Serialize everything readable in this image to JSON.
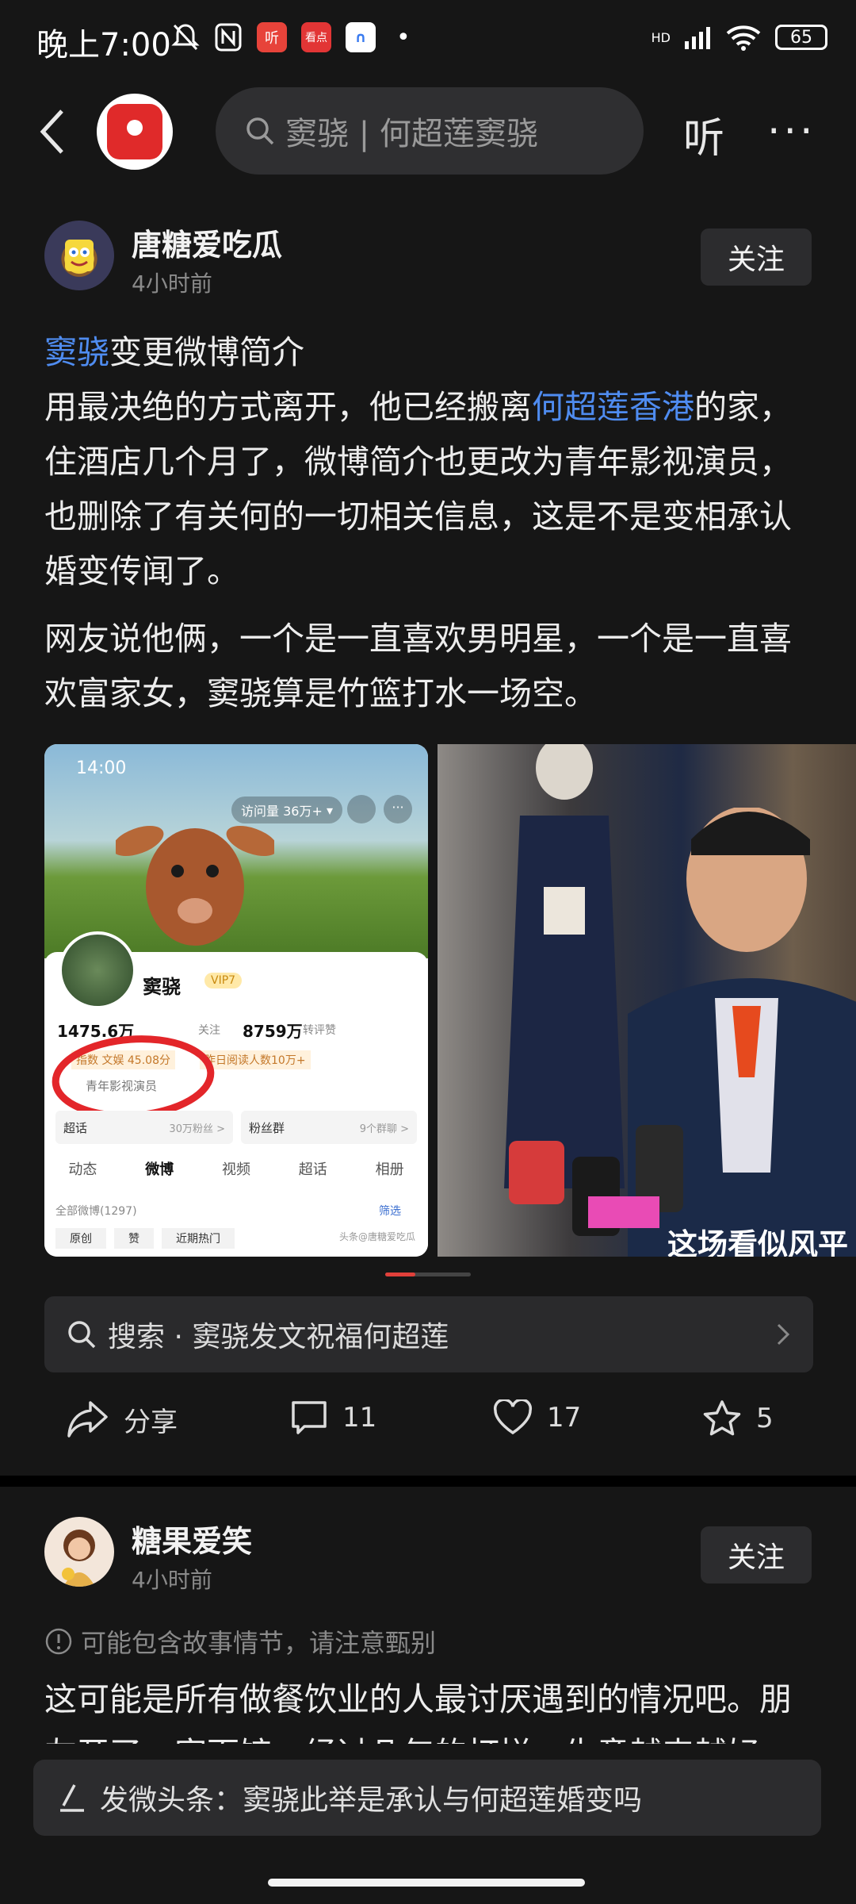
{
  "status": {
    "time": "晚上7:00",
    "battery": "65",
    "signal": "HD"
  },
  "topbar": {
    "search_text": "窦骁 | 何超莲窦骁",
    "listen_label": "听",
    "more_label": "···"
  },
  "post1": {
    "username": "唐糖爱吃瓜",
    "time": "4小时前",
    "follow_label": "关注",
    "line1_link": "窦骁",
    "line1_rest": "变更微博简介",
    "p1_a": "用最决绝的方式离开，他已经搬离",
    "p1_link": "何超莲香港",
    "p1_b": "的家，住酒店几个月了，微博简介也更改为青年影视演员，也删除了有关何的一切相关信息，这是不是变相承认婚变传闻了。",
    "p2": "网友说他俩，一个是一直喜欢男明星，一个是一直喜欢富家女，窦骁算是竹篮打水一场空。",
    "image1": {
      "time": "14:00",
      "visits": "访问量 36万+",
      "name": "窦骁",
      "vip": "VIP7",
      "followers": "1475.6万",
      "follow_word": "关注",
      "likes": "8759万",
      "likes_label": "转评赞",
      "index": "指数 文娱 45.08分",
      "yesterday": "昨日阅读人数10万+",
      "bio": "青年影视演员",
      "chaohua": "超话",
      "chaohua_count": "30万粉丝 >",
      "fans_group": "粉丝群",
      "fans_group_count": "9个群聊 >",
      "tabs": [
        "动态",
        "微博",
        "视频",
        "超话",
        "相册"
      ],
      "all_posts": "全部微博(1297)",
      "filter": "筛选",
      "chip1": "原创",
      "chip2": "赞",
      "chip3": "近期热门",
      "watermark": "头条@唐糖爱吃瓜"
    },
    "image2": {
      "caption": "这场看似风平"
    },
    "related_search": "搜索 · 窦骁发文祝福何超莲",
    "actions": {
      "share": "分享",
      "comments": "11",
      "likes": "17",
      "favorites": "5"
    }
  },
  "post2": {
    "username": "糖果爱笑",
    "time": "4小时前",
    "follow_label": "关注",
    "warning": "可能包含故事情节，请注意甄别",
    "body": "这可能是所有做餐饮业的人最讨厌遇到的情况吧。朋友开了一家面馆，经过几年的打拼，生意越来越好"
  },
  "bottom": {
    "compose": "发微头条：窦骁此举是承认与何超莲婚变吗"
  },
  "colors": {
    "bg": "#161616",
    "link": "#4f8cf0",
    "accent_red": "#e0403a"
  }
}
